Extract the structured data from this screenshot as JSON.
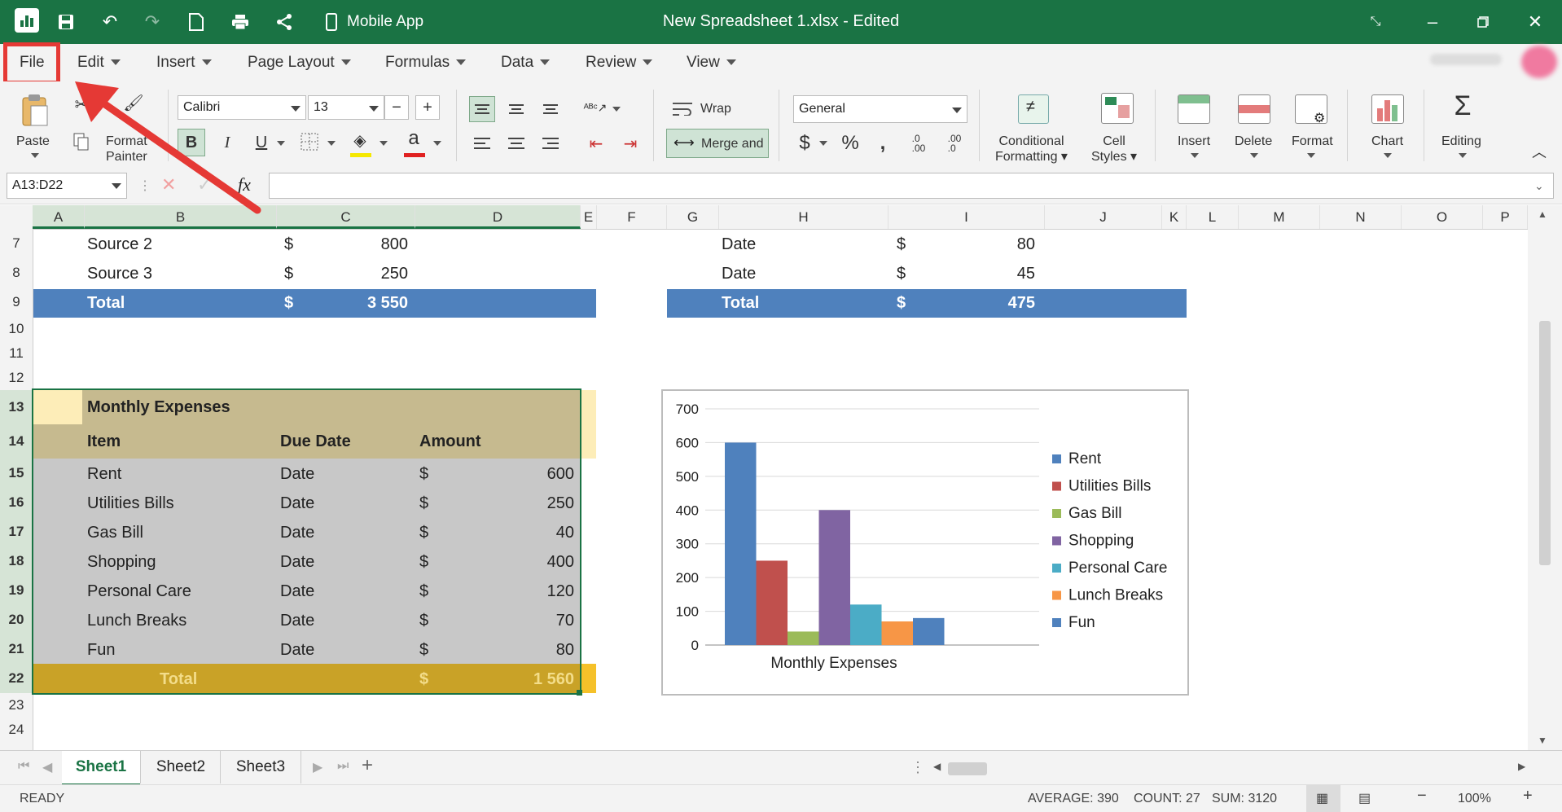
{
  "titlebar": {
    "title": "New Spreadsheet 1.xlsx - Edited",
    "mobile_app": "Mobile App",
    "bg": "#1a7344"
  },
  "menu": {
    "file": "File",
    "edit": "Edit",
    "insert": "Insert",
    "page_layout": "Page Layout",
    "formulas": "Formulas",
    "data": "Data",
    "review": "Review",
    "view": "View"
  },
  "ribbon": {
    "paste": "Paste",
    "format_painter_1": "Format",
    "format_painter_2": "Painter",
    "font_name": "Calibri",
    "font_size": "13",
    "bold": "B",
    "italic": "I",
    "underline": "U",
    "wrap": "Wrap",
    "merge": "Merge and",
    "number_format": "General",
    "cond_fmt_1": "Conditional",
    "cond_fmt_2": "Formatting",
    "cell_styles_1": "Cell",
    "cell_styles_2": "Styles",
    "insert": "Insert",
    "delete": "Delete",
    "format": "Format",
    "chart": "Chart",
    "editing": "Editing"
  },
  "formula_bar": {
    "name_box": "A13:D22",
    "fx": "fx",
    "formula": ""
  },
  "columns": [
    "A",
    "B",
    "C",
    "D",
    "E",
    "F",
    "G",
    "H",
    "I",
    "J",
    "K",
    "L",
    "M",
    "N",
    "O",
    "P"
  ],
  "rows": [
    "7",
    "8",
    "9",
    "10",
    "11",
    "12",
    "13",
    "14",
    "15",
    "16",
    "17",
    "18",
    "19",
    "20",
    "21",
    "22",
    "23",
    "24"
  ],
  "top_left_table": {
    "rows": [
      {
        "label": "Source 2",
        "cur": "$",
        "value": "800"
      },
      {
        "label": "Source 3",
        "cur": "$",
        "value": "250"
      }
    ],
    "total": {
      "label": "Total",
      "cur": "$",
      "value": "3 550"
    }
  },
  "top_right_table": {
    "rows": [
      {
        "label": "Date",
        "cur": "$",
        "value": "80"
      },
      {
        "label": "Date",
        "cur": "$",
        "value": "45"
      }
    ],
    "total": {
      "label": "Total",
      "cur": "$",
      "value": "475"
    }
  },
  "expenses": {
    "title": "Monthly Expenses",
    "headers": {
      "item": "Item",
      "due": "Due Date",
      "amount": "Amount"
    },
    "rows": [
      {
        "item": "Rent",
        "due": "Date",
        "cur": "$",
        "amount": "600"
      },
      {
        "item": "Utilities Bills",
        "due": "Date",
        "cur": "$",
        "amount": "250"
      },
      {
        "item": "Gas Bill",
        "due": "Date",
        "cur": "$",
        "amount": "40"
      },
      {
        "item": "Shopping",
        "due": "Date",
        "cur": "$",
        "amount": "400"
      },
      {
        "item": "Personal Care",
        "due": "Date",
        "cur": "$",
        "amount": "120"
      },
      {
        "item": "Lunch Breaks",
        "due": "Date",
        "cur": "$",
        "amount": "70"
      },
      {
        "item": "Fun",
        "due": "Date",
        "cur": "$",
        "amount": "80"
      }
    ],
    "total": {
      "label": "Total",
      "cur": "$",
      "amount": "1 560"
    }
  },
  "chart_data": {
    "type": "bar",
    "categories": [
      "Monthly Expenses"
    ],
    "xlabel": "Monthly Expenses",
    "ylim": [
      0,
      700
    ],
    "yticks": [
      0,
      100,
      200,
      300,
      400,
      500,
      600,
      700
    ],
    "grid": true,
    "legend_position": "right",
    "series": [
      {
        "name": "Rent",
        "values": [
          600
        ],
        "color": "#4f81bd"
      },
      {
        "name": "Utilities Bills",
        "values": [
          250
        ],
        "color": "#c0504d"
      },
      {
        "name": "Gas Bill",
        "values": [
          40
        ],
        "color": "#9bbb59"
      },
      {
        "name": "Shopping",
        "values": [
          400
        ],
        "color": "#8064a2"
      },
      {
        "name": "Personal Care",
        "values": [
          120
        ],
        "color": "#4bacc6"
      },
      {
        "name": "Lunch Breaks",
        "values": [
          70
        ],
        "color": "#f79646"
      },
      {
        "name": "Fun",
        "values": [
          80
        ],
        "color": "#4f81bd"
      }
    ]
  },
  "tabs": [
    "Sheet1",
    "Sheet2",
    "Sheet3"
  ],
  "status": {
    "ready": "READY",
    "average": "AVERAGE: 390",
    "count": "COUNT: 27",
    "sum": "SUM: 3120",
    "zoom": "100%"
  }
}
